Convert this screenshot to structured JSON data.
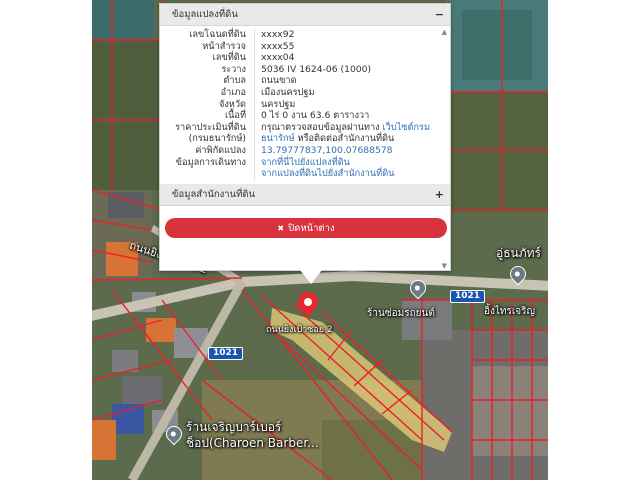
{
  "popup": {
    "section1_title": "ข้อมูลแปลงที่ดิน",
    "section1_toggle": "−",
    "rows": [
      {
        "label": "เลขโฉนดที่ดิน",
        "value": "xxxx92"
      },
      {
        "label": "หน้าสำรวจ",
        "value": "xxxx55"
      },
      {
        "label": "เลขที่ดิน",
        "value": "xxxx04"
      },
      {
        "label": "ระวาง",
        "value": "5036 IV 1624-06 (1000)"
      },
      {
        "label": "ตำบล",
        "value": "ถนนขาด"
      },
      {
        "label": "อำเภอ",
        "value": "เมืองนครปฐม"
      },
      {
        "label": "จังหวัด",
        "value": "นครปฐม"
      },
      {
        "label": "เนื้อที่",
        "value": "0 ไร่ 0 งาน 63.6 ตารางวา"
      }
    ],
    "price_label": "ราคาประเมินที่ดิน",
    "price_text": "กรุณาตรวจสอบข้อมูลผ่านทาง",
    "price_link": "เว็บไซต์กรม",
    "price_label2": "(กรมธนารักษ์)",
    "price_link2": "ธนารักษ์",
    "price_text2": "หรือติดต่อสำนักงานที่ดิน",
    "coord_label": "ค่าพิกัดแปลง",
    "coord_value": "13.79777837,100.07688578",
    "nav_label": "ข้อมูลการเดินทาง",
    "nav_link1": "จากที่นี่ไปยังแปลงที่ดิน",
    "nav_link2": "จากแปลงที่ดินไปยังสำนักงานที่ดิน",
    "section2_title": "ข้อมูลสำนักงานที่ดิน",
    "section2_toggle": "+",
    "close_label": "ปิดหน้าต่าง",
    "close_icon": "✖"
  },
  "map": {
    "labels": {
      "road_1": "ถนนยิงเป้าซอย 2",
      "road_2": "ถนนยิงเป้า",
      "marker_label": "ถนนยิงเป้าซอย 2",
      "shop_1": "ร้านซ่อมรถยนต์",
      "shop_2": "อู่ธนภัทร์",
      "shop_3": "อิ้งไทรเจริญ",
      "barber_1": "ร้านเจริญบาร์เบอร์",
      "barber_2": "ช็อป(Charoen Barber..."
    },
    "road_shields": [
      "1021",
      "1021"
    ],
    "colors": {
      "parcel_line": "#e8202a",
      "highlight_fill": "#e8d27a",
      "marker": "#e8282e",
      "close_button": "#d8323c",
      "link": "#2f6fb5"
    }
  }
}
